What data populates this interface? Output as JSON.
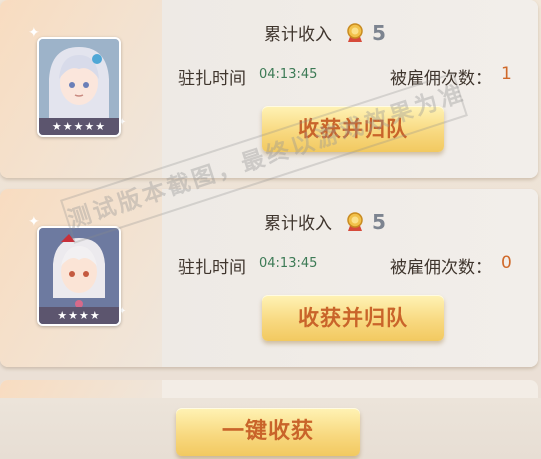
{
  "cards": [
    {
      "income_label": "累计收入",
      "income_value": "5",
      "time_label": "驻扎时间",
      "time_value": "04:13:45",
      "hire_label": "被雇佣次数：",
      "hire_value": "1",
      "button_label": "收获并归队",
      "stars": "★★★★★"
    },
    {
      "income_label": "累计收入",
      "income_value": "5",
      "time_label": "驻扎时间",
      "time_value": "04:13:45",
      "hire_label": "被雇佣次数：",
      "hire_value": "0",
      "button_label": "收获并归队",
      "stars": "★★★★"
    }
  ],
  "collect_all_label": "一键收获",
  "watermark": "测试版本截图，最终以游戏效果为准"
}
